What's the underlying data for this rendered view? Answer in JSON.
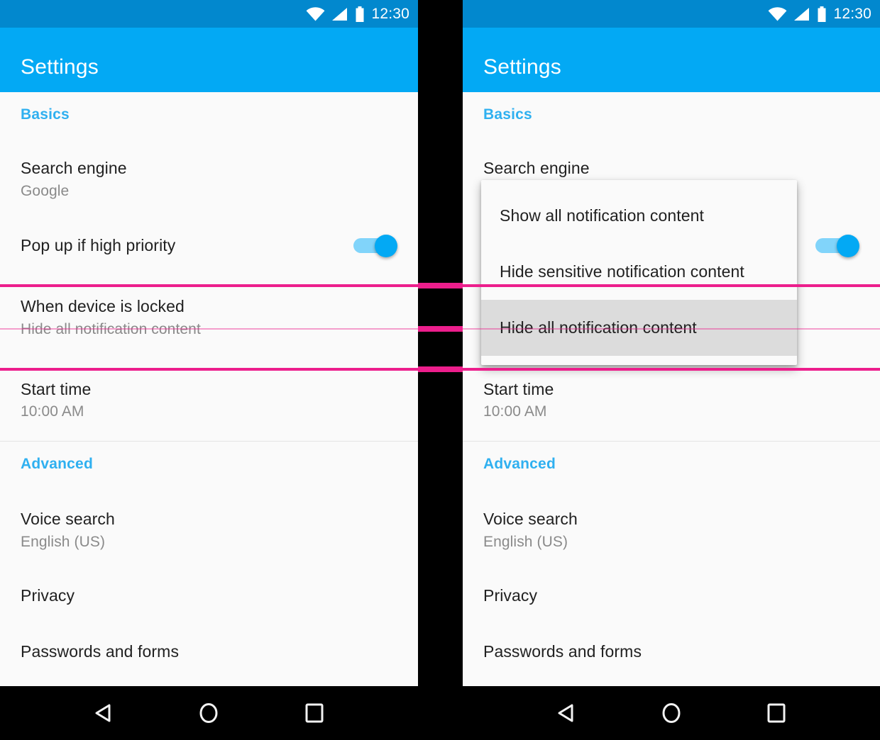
{
  "status_bar": {
    "time": "12:30",
    "icons": [
      "wifi-icon",
      "cell-signal-icon",
      "battery-icon"
    ]
  },
  "app_bar": {
    "title": "Settings"
  },
  "colors": {
    "status_bar_bg": "#0288ce",
    "app_bar_bg": "#03a9f4",
    "accent": "#2fb0f0",
    "list_bg": "#fafafa",
    "annotation_line": "#ec1e8c",
    "selected_item_bg": "#dcdcdc",
    "switch_track_on": "#81d4fa",
    "switch_thumb_on": "#03a9f4",
    "nav_bar_bg": "#000000"
  },
  "sections": [
    {
      "header": "Basics",
      "rows": [
        {
          "title": "Search engine",
          "subtitle": "Google",
          "control": "none"
        },
        {
          "title": "Pop up if high priority",
          "subtitle": "",
          "control": "switch",
          "switch_state": "on"
        },
        {
          "title": "When device is locked",
          "subtitle": "Hide all notification content",
          "control": "none",
          "highlighted": true
        },
        {
          "title": "Start time",
          "subtitle": "10:00 AM",
          "control": "none"
        }
      ]
    },
    {
      "header": "Advanced",
      "rows": [
        {
          "title": "Voice search",
          "subtitle": "English (US)",
          "control": "none"
        },
        {
          "title": "Privacy",
          "subtitle": "",
          "control": "none"
        },
        {
          "title": "Passwords and forms",
          "subtitle": "",
          "control": "none"
        }
      ]
    }
  ],
  "popup_menu": {
    "items": [
      {
        "label": "Show all notification content",
        "selected": false
      },
      {
        "label": "Hide sensitive notification content",
        "selected": false
      },
      {
        "label": "Hide all notification content",
        "selected": true
      }
    ]
  },
  "nav_bar": {
    "buttons": [
      {
        "name": "back-button",
        "icon": "back-triangle-icon"
      },
      {
        "name": "home-button",
        "icon": "home-circle-icon"
      },
      {
        "name": "recents-button",
        "icon": "recents-square-icon"
      }
    ]
  }
}
